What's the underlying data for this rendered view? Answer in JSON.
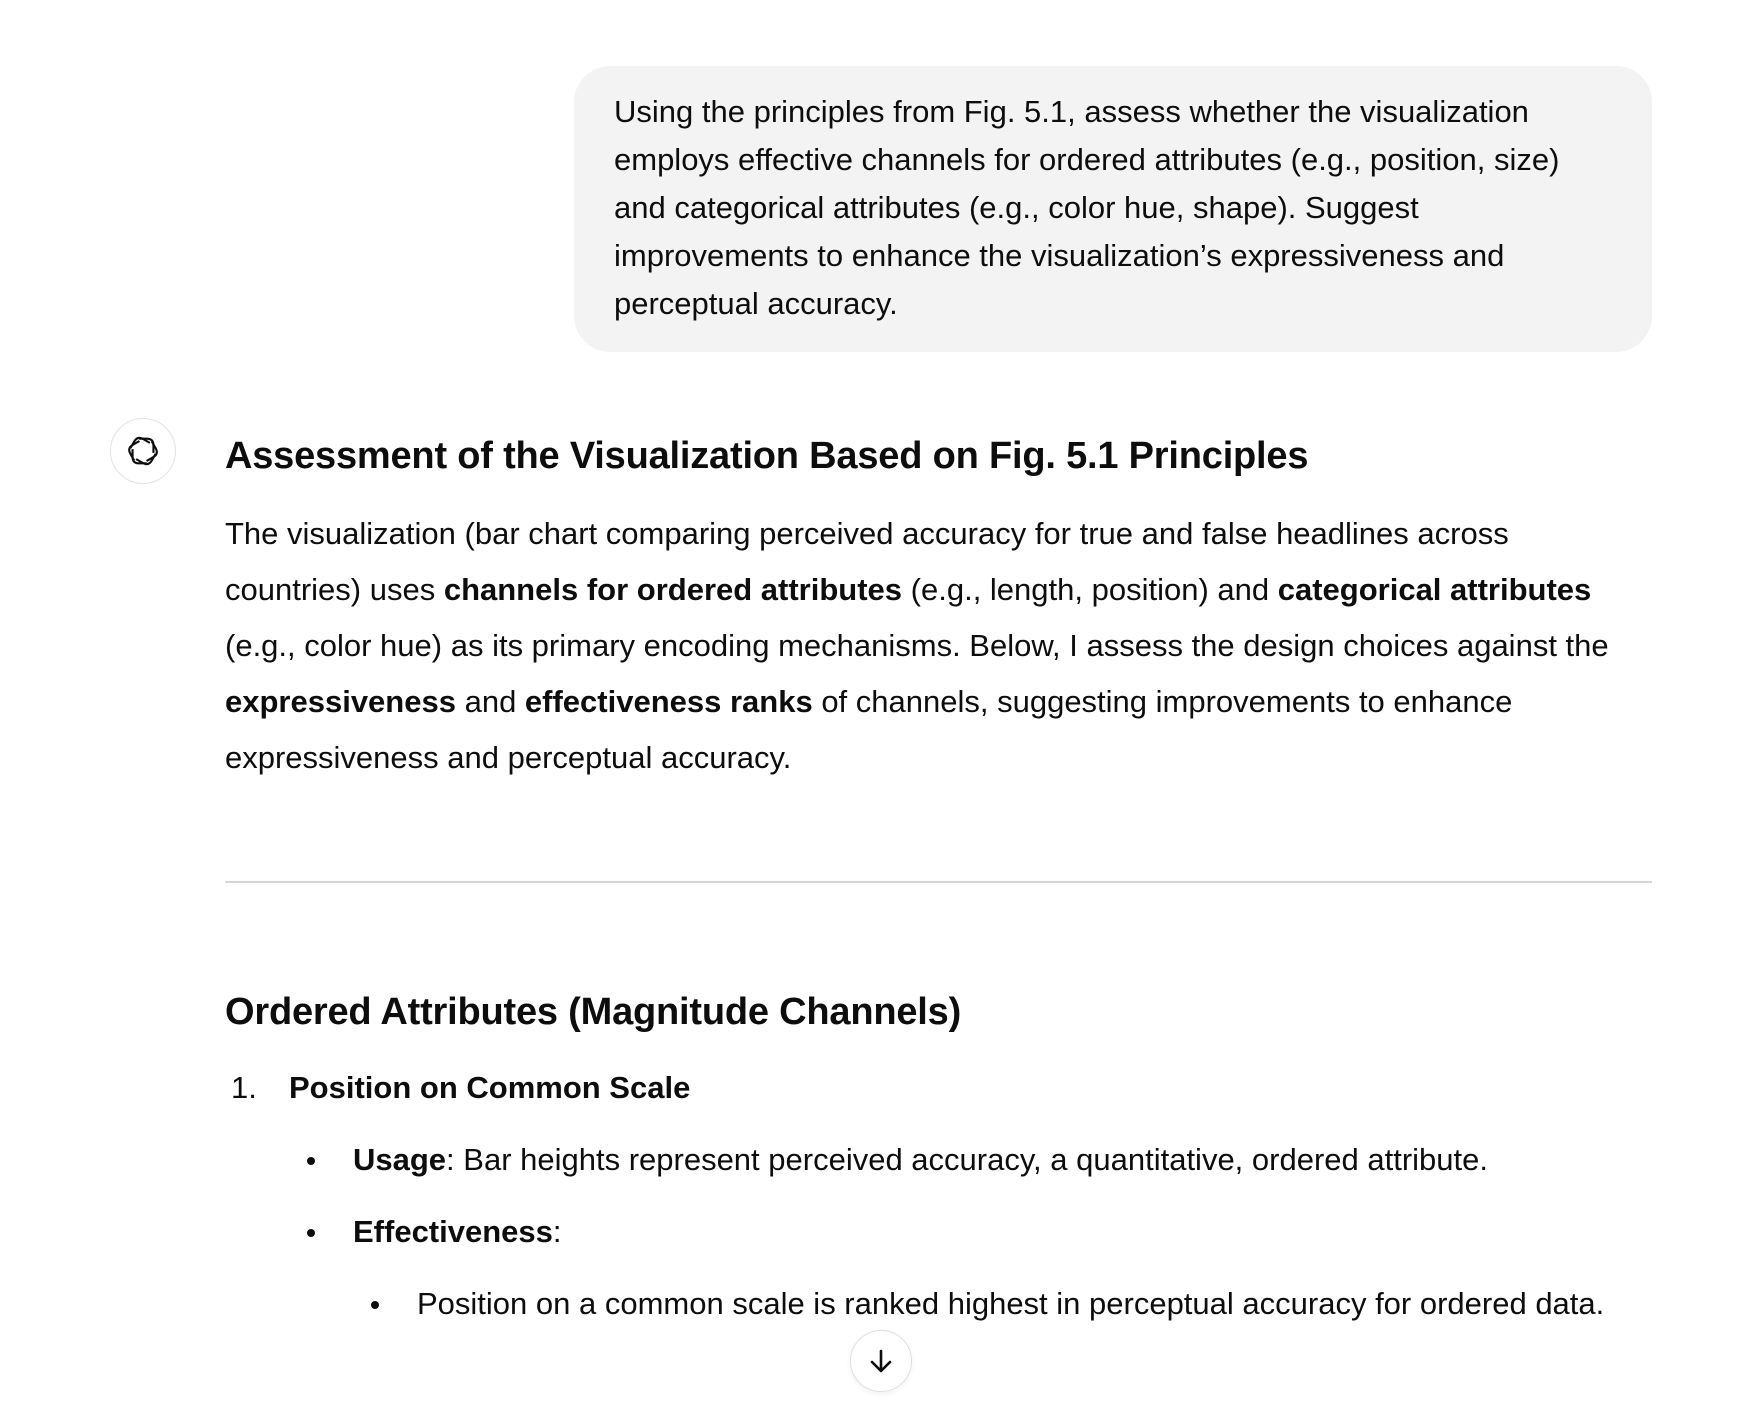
{
  "user_message": {
    "text": "Using the principles from Fig. 5.1, assess whether the visualization employs effective channels for ordered attributes (e.g., position, size) and categorical attributes (e.g., color hue, shape). Suggest improvements to enhance the visualization’s expressiveness and perceptual accuracy."
  },
  "assistant": {
    "avatar_icon": "openai-logo-icon",
    "heading": "Assessment of the Visualization Based on Fig. 5.1 Principles",
    "intro": {
      "t1": "The visualization (bar chart comparing perceived accuracy for true and false headlines across countries) uses ",
      "b1": "channels for ordered attributes",
      "t2": " (e.g., length, position) and ",
      "b2": "categorical attributes",
      "t3": " (e.g., color hue) as its primary encoding mechanisms. Below, I assess the design choices against the ",
      "b3": "expressiveness",
      "t4": " and ",
      "b4": "effectiveness ranks",
      "t5": " of channels, suggesting improvements to enhance expressiveness and perceptual accuracy."
    },
    "section_heading": "Ordered Attributes (Magnitude Channels)",
    "list": [
      {
        "number": "1.",
        "title": "Position on Common Scale",
        "usage_label": "Usage",
        "usage_text": ": Bar heights represent perceived accuracy, a quantitative, ordered attribute.",
        "effectiveness_label": "Effectiveness",
        "effectiveness_suffix": ":",
        "sub_bullet": "Position on a common scale is ranked highest in perceptual accuracy for ordered data."
      }
    ]
  },
  "scroll_button": {
    "icon": "arrow-down-icon"
  }
}
